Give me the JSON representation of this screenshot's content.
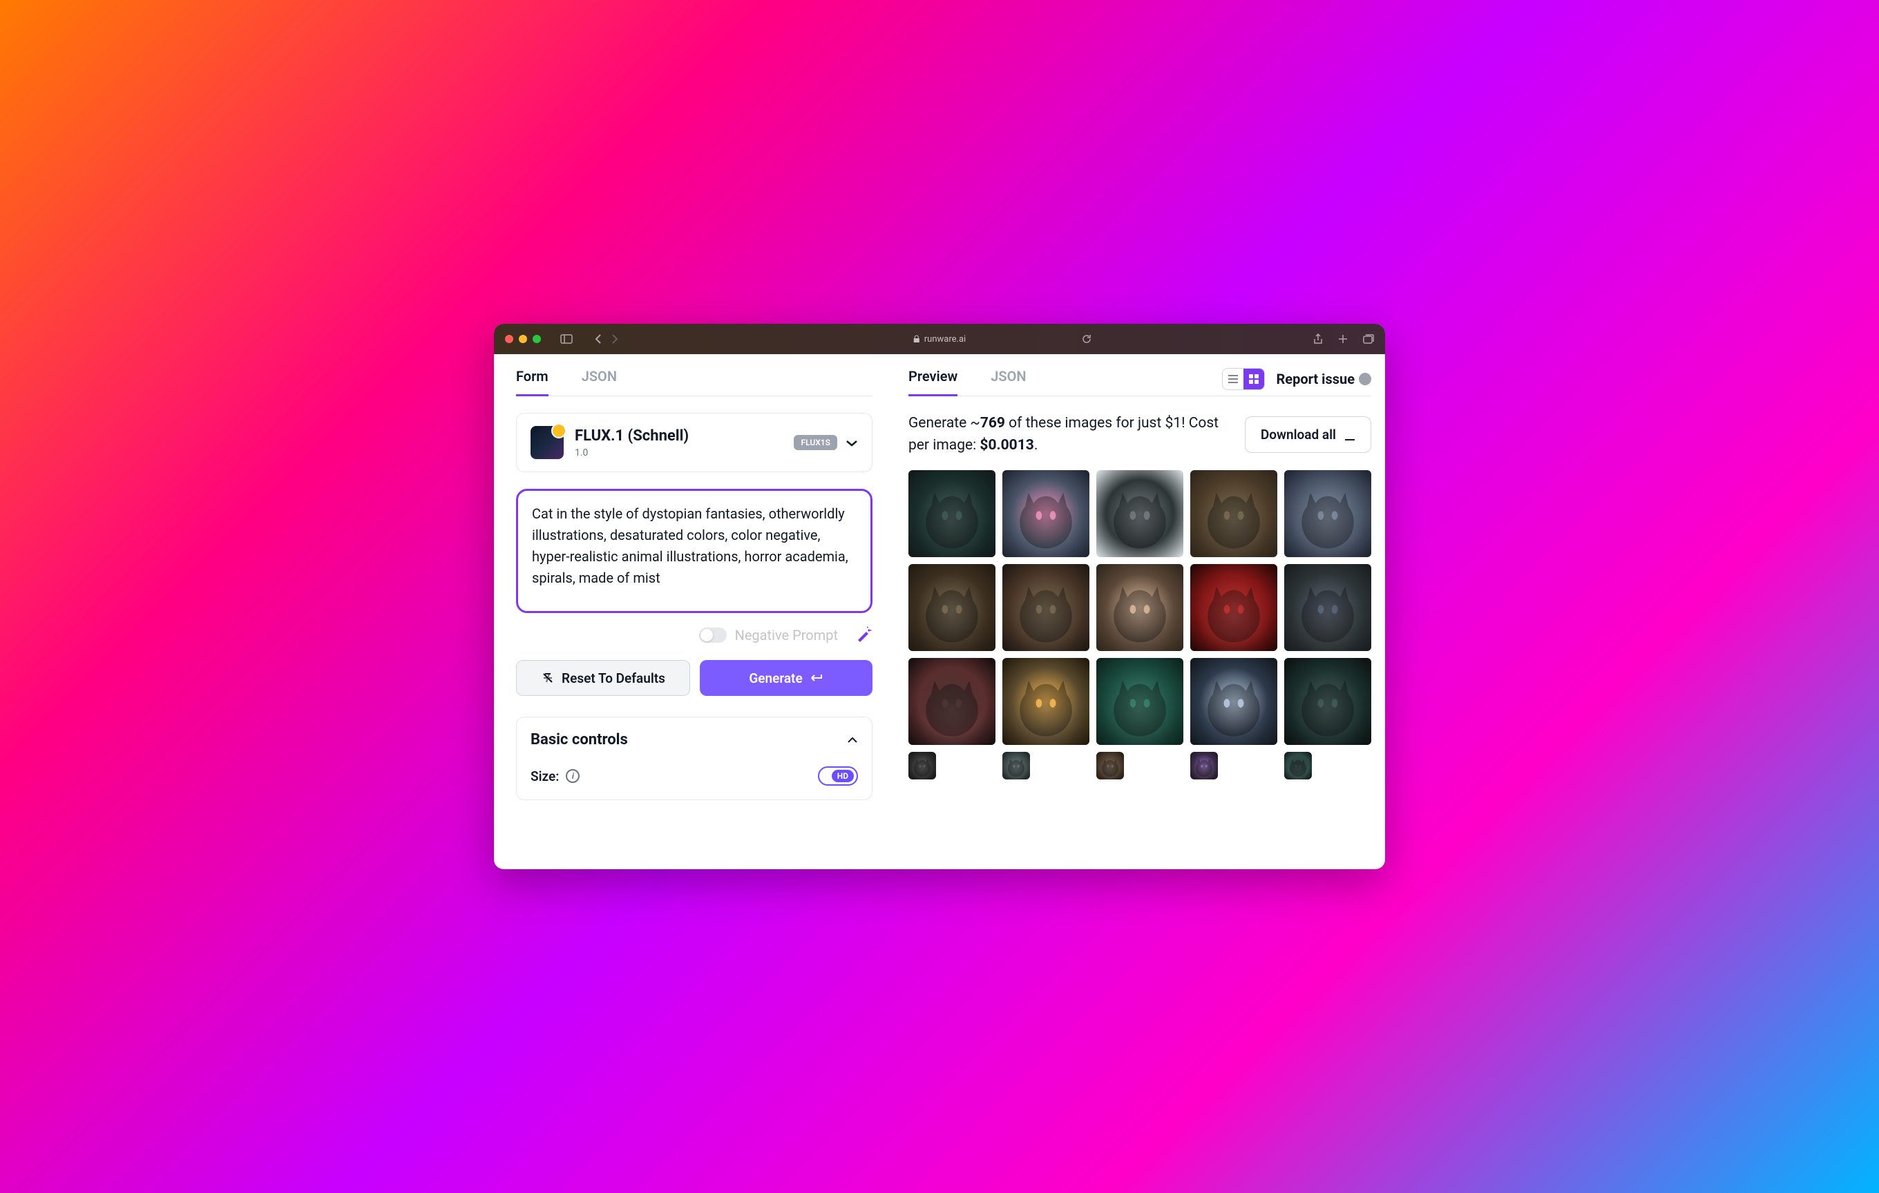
{
  "browser": {
    "url_display": "runware.ai"
  },
  "leftPane": {
    "tabs": {
      "form": "Form",
      "json": "JSON"
    },
    "model": {
      "name": "FLUX.1 (Schnell)",
      "version": "1.0",
      "badge": "FLUX1S"
    },
    "prompt": "Cat in the style of dystopian fantasies, otherworldly illustrations, desaturated colors, color negative, hyper-realistic animal illustrations, horror academia, spirals, made of mist",
    "negativePromptLabel": "Negative Prompt",
    "resetLabel": "Reset To Defaults",
    "generateLabel": "Generate",
    "basicControls": {
      "title": "Basic controls",
      "sizeLabel": "Size:",
      "hdLabel": "HD"
    }
  },
  "rightPane": {
    "tabs": {
      "preview": "Preview",
      "json": "JSON"
    },
    "reportIssue": "Report issue",
    "cost": {
      "prefix": "Generate ~",
      "count": "769",
      "middle": " of these images for just $1! Cost per image: ",
      "price": "$0.0013",
      "suffix": "."
    },
    "downloadLabel": "Download all",
    "gridPalettes": [
      [
        "#1a2f2c",
        "#2d4a45",
        "#0f1817"
      ],
      [
        "#4a5568",
        "#ec87b5",
        "#1a202c"
      ],
      [
        "#2d3436",
        "#636e72",
        "#dfe6e9"
      ],
      [
        "#4d3d29",
        "#6b5b3f",
        "#2a2319"
      ],
      [
        "#4a5568",
        "#718096",
        "#1a202c"
      ],
      [
        "#3d3020",
        "#6b5b3f",
        "#1f1810"
      ],
      [
        "#4a3728",
        "#6b5b3f",
        "#1a1410"
      ],
      [
        "#5c4838",
        "#d4af8f",
        "#2a2319"
      ],
      [
        "#801515",
        "#b71c1c",
        "#1a0505"
      ],
      [
        "#2d3436",
        "#4a5568",
        "#151a1f"
      ],
      [
        "#5a2d2d",
        "#3d1f1f",
        "#0f0a0a"
      ],
      [
        "#5a4a2d",
        "#f5b042",
        "#1a1408"
      ],
      [
        "#1a4a3d",
        "#26735c",
        "#0a1f18"
      ],
      [
        "#2d3a4a",
        "#b0c4de",
        "#0f141a"
      ],
      [
        "#1a2f2c",
        "#2d4a45",
        "#0a0f0e"
      ],
      [
        "#2d2d2d",
        "#4a4a4a",
        "#0f0f0f"
      ],
      [
        "#3d4a4a",
        "#5a6b6b",
        "#141a1a"
      ],
      [
        "#4a3a2d",
        "#6b5540",
        "#1a1408"
      ],
      [
        "#3d2d4a",
        "#8b5fb8",
        "#1a0f1f"
      ],
      [
        "#2d4a45",
        "#1a2f2c",
        "#0a0f0e"
      ]
    ]
  }
}
